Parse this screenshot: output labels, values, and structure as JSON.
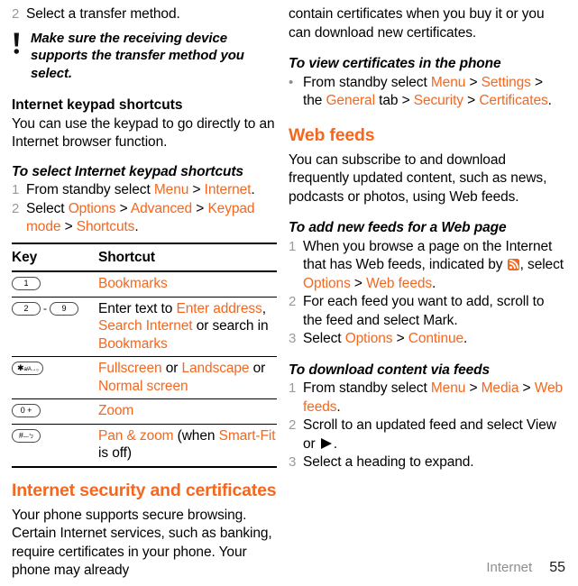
{
  "document": {
    "footer": {
      "section": "Internet",
      "page_number": "55"
    }
  },
  "left_column": {
    "top_step": {
      "number": "2",
      "text": "Select a transfer method."
    },
    "note": {
      "icon": "exclamation-tip-icon",
      "text": "Make sure the receiving device supports the transfer method you select."
    },
    "keypad_section": {
      "heading": "Internet keypad shortcuts",
      "paragraph": "You can use the keypad to go directly to an Internet browser function.",
      "procedure_title": "To select Internet keypad shortcuts",
      "steps": [
        {
          "number": "1",
          "parts": [
            {
              "text": "From standby select ",
              "color": "black"
            },
            {
              "text": "Menu",
              "color": "orange"
            },
            {
              "text": " > ",
              "color": "black"
            },
            {
              "text": "Internet",
              "color": "orange"
            },
            {
              "text": ".",
              "color": "black"
            }
          ]
        },
        {
          "number": "2",
          "parts": [
            {
              "text": "Select ",
              "color": "black"
            },
            {
              "text": "Options",
              "color": "orange"
            },
            {
              "text": " > ",
              "color": "black"
            },
            {
              "text": "Advanced",
              "color": "orange"
            },
            {
              "text": " > ",
              "color": "black"
            },
            {
              "text": "Keypad mode",
              "color": "orange"
            },
            {
              "text": " > ",
              "color": "black"
            },
            {
              "text": "Shortcuts",
              "color": "orange"
            },
            {
              "text": ".",
              "color": "black"
            }
          ]
        }
      ]
    },
    "shortcut_table": {
      "headers": [
        "Key",
        "Shortcut"
      ],
      "rows": [
        {
          "key_glyphs": [
            {
              "type": "keycap",
              "label": "1",
              "sub": ""
            }
          ],
          "shortcut_parts": [
            {
              "text": "Bookmarks",
              "color": "orange"
            }
          ]
        },
        {
          "key_glyphs": [
            {
              "type": "keycap",
              "label": "2",
              "sub": ""
            },
            {
              "type": "dash",
              "label": "-",
              "sub": ""
            },
            {
              "type": "keycap",
              "label": "9",
              "sub": ""
            }
          ],
          "shortcut_parts": [
            {
              "text": "Enter text to ",
              "color": "black"
            },
            {
              "text": "Enter address",
              "color": "orange"
            },
            {
              "text": ", ",
              "color": "black"
            },
            {
              "text": "Search Internet",
              "color": "orange"
            },
            {
              "text": " or search in ",
              "color": "black"
            },
            {
              "text": "Bookmarks",
              "color": "orange"
            }
          ]
        },
        {
          "key_glyphs": [
            {
              "type": "keycap",
              "label": "✱",
              "sub": "a/A→₀"
            }
          ],
          "shortcut_parts": [
            {
              "text": "Fullscreen",
              "color": "orange"
            },
            {
              "text": " or ",
              "color": "black"
            },
            {
              "text": "Landscape",
              "color": "orange"
            },
            {
              "text": " or ",
              "color": "black"
            },
            {
              "text": "Normal screen",
              "color": "orange"
            }
          ]
        },
        {
          "key_glyphs": [
            {
              "type": "keycap",
              "label": "0 +",
              "sub": ""
            }
          ],
          "shortcut_parts": [
            {
              "text": "Zoom",
              "color": "orange"
            }
          ]
        },
        {
          "key_glyphs": [
            {
              "type": "keycap",
              "label": "#",
              "sub": "—ㄅ"
            }
          ],
          "shortcut_parts": [
            {
              "text": "Pan & zoom",
              "color": "orange"
            },
            {
              "text": " (when ",
              "color": "black"
            },
            {
              "text": "Smart-Fit",
              "color": "orange"
            },
            {
              "text": " is off)",
              "color": "black"
            }
          ]
        }
      ]
    },
    "security_section": {
      "heading": "Internet security and certificates",
      "paragraph": "Your phone supports secure browsing. Certain Internet services, such as banking, require certificates in your phone. Your phone may already"
    }
  },
  "right_column": {
    "continued_paragraph": "contain certificates when you buy it or you can download new certificates.",
    "view_certificates": {
      "procedure_title": "To view certificates in the phone",
      "bullet": "•",
      "parts": [
        {
          "text": "From standby select ",
          "color": "black"
        },
        {
          "text": "Menu",
          "color": "orange"
        },
        {
          "text": " > ",
          "color": "black"
        },
        {
          "text": "Settings",
          "color": "orange"
        },
        {
          "text": " > the ",
          "color": "black"
        },
        {
          "text": "General",
          "color": "orange"
        },
        {
          "text": " tab > ",
          "color": "black"
        },
        {
          "text": "Security",
          "color": "orange"
        },
        {
          "text": " > ",
          "color": "black"
        },
        {
          "text": "Certificates",
          "color": "orange"
        },
        {
          "text": ".",
          "color": "black"
        }
      ]
    },
    "web_feeds": {
      "heading": "Web feeds",
      "paragraph": "You can subscribe to and download frequently updated content, such as news, podcasts or photos, using Web feeds.",
      "add_feeds": {
        "procedure_title": "To add new feeds for a Web page",
        "steps": [
          {
            "number": "1",
            "parts": [
              {
                "text": "When you browse a page on the Internet that has Web feeds, indicated by ",
                "color": "black"
              },
              {
                "type": "icon",
                "icon": "rss-feed-icon"
              },
              {
                "text": ", select ",
                "color": "black"
              },
              {
                "text": "Options",
                "color": "orange"
              },
              {
                "text": " > ",
                "color": "black"
              },
              {
                "text": "Web feeds",
                "color": "orange"
              },
              {
                "text": ".",
                "color": "black"
              }
            ]
          },
          {
            "number": "2",
            "parts": [
              {
                "text": "For each feed you want to add, scroll to the feed and select Mark.",
                "color": "black"
              }
            ]
          },
          {
            "number": "3",
            "parts": [
              {
                "text": "Select ",
                "color": "black"
              },
              {
                "text": "Options",
                "color": "orange"
              },
              {
                "text": " > ",
                "color": "black"
              },
              {
                "text": "Continue",
                "color": "orange"
              },
              {
                "text": ".",
                "color": "black"
              }
            ]
          }
        ]
      },
      "download_feeds": {
        "procedure_title": "To download content via feeds",
        "steps": [
          {
            "number": "1",
            "parts": [
              {
                "text": "From standby select ",
                "color": "black"
              },
              {
                "text": "Menu",
                "color": "orange"
              },
              {
                "text": " > ",
                "color": "black"
              },
              {
                "text": "Media",
                "color": "orange"
              },
              {
                "text": " > ",
                "color": "black"
              },
              {
                "text": "Web feeds",
                "color": "orange"
              },
              {
                "text": ".",
                "color": "black"
              }
            ]
          },
          {
            "number": "2",
            "parts": [
              {
                "text": "Scroll to an updated feed and select View or ",
                "color": "black"
              },
              {
                "type": "icon",
                "icon": "play-arrow-icon"
              },
              {
                "text": ".",
                "color": "black"
              }
            ]
          },
          {
            "number": "3",
            "parts": [
              {
                "text": "Select a heading to expand.",
                "color": "black"
              }
            ]
          }
        ]
      }
    }
  },
  "colors": {
    "accent_orange": "#F4671F",
    "step_number_gray": "#9a9a9a",
    "footer_gray": "#8e8e8e"
  }
}
